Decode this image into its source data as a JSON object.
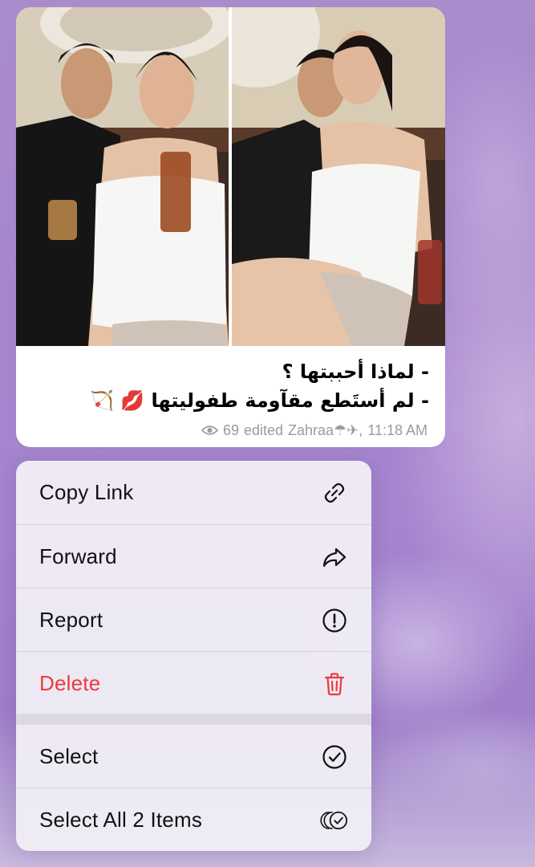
{
  "message": {
    "caption_lines": [
      "- لماذا أحببتها ؟",
      "- لم أستَطع مقآومة طفوليتها 💋 🏹"
    ],
    "views": "69",
    "status": "edited",
    "author": "Zahraa☂✈,",
    "time": "11:18 AM",
    "photos": [
      {
        "icon": "photo-couple-left"
      },
      {
        "icon": "photo-couple-right"
      }
    ]
  },
  "menu": {
    "items": [
      {
        "label": "Copy Link",
        "icon": "link-icon"
      },
      {
        "label": "Forward",
        "icon": "forward-arrow-icon"
      },
      {
        "label": "Report",
        "icon": "exclamation-circle-icon"
      },
      {
        "label": "Delete",
        "icon": "trash-icon",
        "color": "#ea3b3a"
      },
      {
        "label": "Select",
        "icon": "checkmark-circle-icon"
      },
      {
        "label": "Select All 2 Items",
        "icon": "multi-checkmark-circle-icon"
      }
    ]
  },
  "colors": {
    "background": "#a586cc",
    "destructive": "#ea3b3a",
    "meta_text": "#9a9aa2"
  }
}
